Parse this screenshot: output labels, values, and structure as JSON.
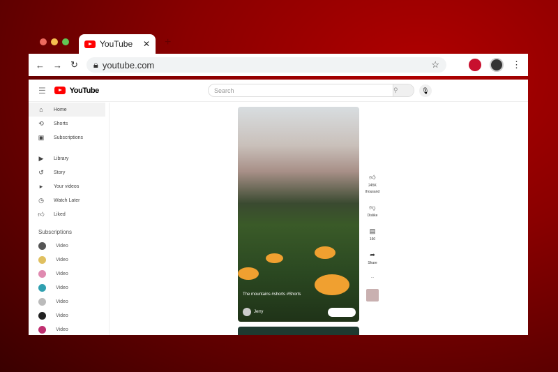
{
  "browser": {
    "tab_title": "YouTube",
    "url": "youtube.com",
    "colors": {
      "close": "#ed6a5e",
      "min": "#f5bf4f",
      "max": "#61c554"
    }
  },
  "youtube": {
    "logo": "YouTube",
    "search_placeholder": "Search",
    "nav": [
      {
        "label": "Home",
        "icon": "home-icon"
      },
      {
        "label": "Shorts",
        "icon": "shorts-icon"
      },
      {
        "label": "Subscriptions",
        "icon": "subscriptions-icon"
      }
    ],
    "library": [
      {
        "label": "Library",
        "icon": "library-icon"
      },
      {
        "label": "Story",
        "icon": "history-icon"
      },
      {
        "label": "Your videos",
        "icon": "your-videos-icon"
      },
      {
        "label": "Watch Later",
        "icon": "clock-icon"
      },
      {
        "label": "Liked",
        "icon": "like-icon"
      }
    ],
    "subscriptions_heading": "Subscriptions",
    "subscriptions": [
      {
        "label": "Video",
        "color": "#555"
      },
      {
        "label": "Video",
        "color": "#e0c060"
      },
      {
        "label": "Video",
        "color": "#e08ab0"
      },
      {
        "label": "Video",
        "color": "#30a0b0"
      },
      {
        "label": "Video",
        "color": "#bbb"
      },
      {
        "label": "Video",
        "color": "#222"
      },
      {
        "label": "Video",
        "color": "#c03070"
      }
    ],
    "short": {
      "caption": "The mountains #shorts #Shorts",
      "channel": "Jerry"
    },
    "actions": {
      "likes": "245K",
      "likes_unit": "thousand",
      "dislike": "Dislike",
      "comments": "160",
      "share": "Share",
      "more": "..."
    }
  }
}
